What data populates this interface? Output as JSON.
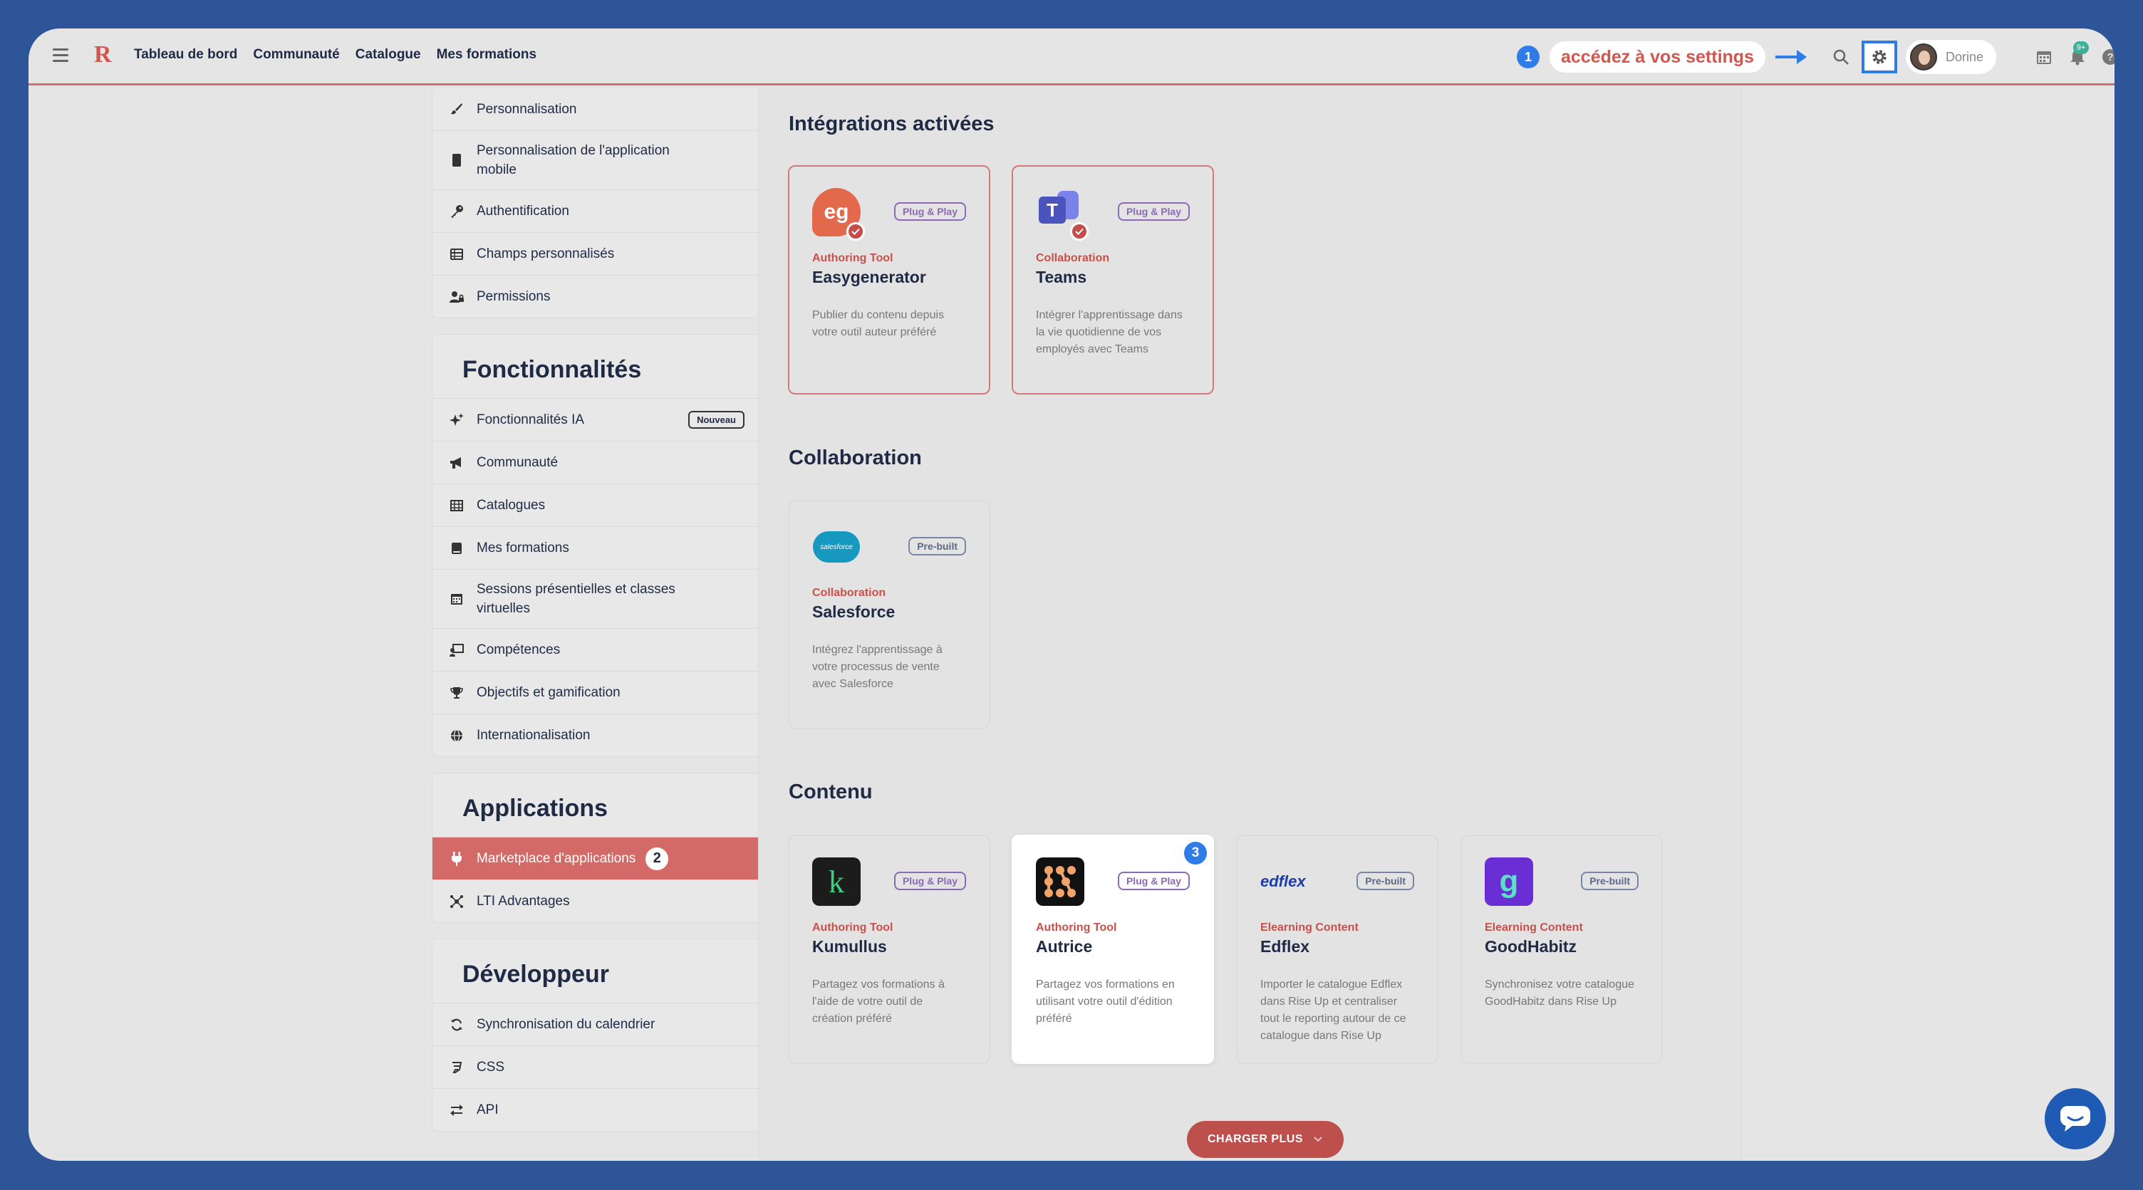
{
  "topbar": {
    "logo": "R",
    "nav": [
      "Tableau de bord",
      "Communauté",
      "Catalogue",
      "Mes formations"
    ],
    "annotation_num": "1",
    "annotation_text": "accédez à vos settings",
    "user_name": "Dorine",
    "notif_badge": "9+"
  },
  "sidebar": {
    "top_items": [
      "Personnalisation",
      "Personnalisation de l'application mobile",
      "Authentification",
      "Champs personnalisés",
      "Permissions"
    ],
    "features_title": "Fonctionnalités",
    "features_items": [
      "Fonctionnalités IA",
      "Communauté",
      "Catalogues",
      "Mes formations",
      "Sessions présentielles et classes virtuelles",
      "Compétences",
      "Objectifs et gamification",
      "Internationalisation"
    ],
    "nouveau": "Nouveau",
    "apps_title": "Applications",
    "apps_items": [
      "Marketplace d'applications",
      "LTI Advantages"
    ],
    "apps_num": "2",
    "dev_title": "Développeur",
    "dev_items": [
      "Synchronisation du calendrier",
      "CSS",
      "API"
    ]
  },
  "main": {
    "sections": [
      "Intégrations activées",
      "Collaboration",
      "Contenu"
    ],
    "tiles": [
      {
        "name": "Easygenerator",
        "category": "Authoring Tool",
        "tag": "Plug & Play",
        "desc": "Publier du contenu depuis votre outil auteur préféré",
        "logo": "eg"
      },
      {
        "name": "Teams",
        "category": "Collaboration",
        "tag": "Plug & Play",
        "desc": "Intégrer l'apprentissage dans la vie quotidienne de vos employés avec Teams",
        "logo": "T"
      },
      {
        "name": "Salesforce",
        "category": "Collaboration",
        "tag": "Pre-built",
        "desc": "Intégrez l'apprentissage à votre processus de vente avec Salesforce",
        "logo": "salesforce"
      },
      {
        "name": "Kumullus",
        "category": "Authoring Tool",
        "tag": "Plug & Play",
        "desc": "Partagez vos formations à l'aide de votre outil de création préféré",
        "logo": "k"
      },
      {
        "name": "Autrice",
        "category": "Authoring Tool",
        "tag": "Plug & Play",
        "desc": "Partagez vos formations en utilisant votre outil d'édition préféré",
        "logo": "autrice"
      },
      {
        "name": "Edflex",
        "category": "Elearning Content",
        "tag": "Pre-built",
        "desc": "Importer le catalogue Edflex dans Rise Up et centraliser tout le reporting autour de ce catalogue dans Rise Up",
        "logo": "edflex"
      },
      {
        "name": "GoodHabitz",
        "category": "Elearning Content",
        "tag": "Pre-built",
        "desc": "Synchronisez votre catalogue GoodHabitz dans Rise Up",
        "logo": "g"
      }
    ],
    "highlight_num": "3",
    "load_more": "CHARGER PLUS"
  },
  "colors": {
    "accent": "#d36a67",
    "brand_red": "#c8504a",
    "annotation_blue": "#2f7be8",
    "background": "#2e5597"
  },
  "icons": [
    "menu-icon",
    "search-icon",
    "gear-icon",
    "calendar-icon",
    "bell-icon",
    "help-icon",
    "chat-icon"
  ]
}
